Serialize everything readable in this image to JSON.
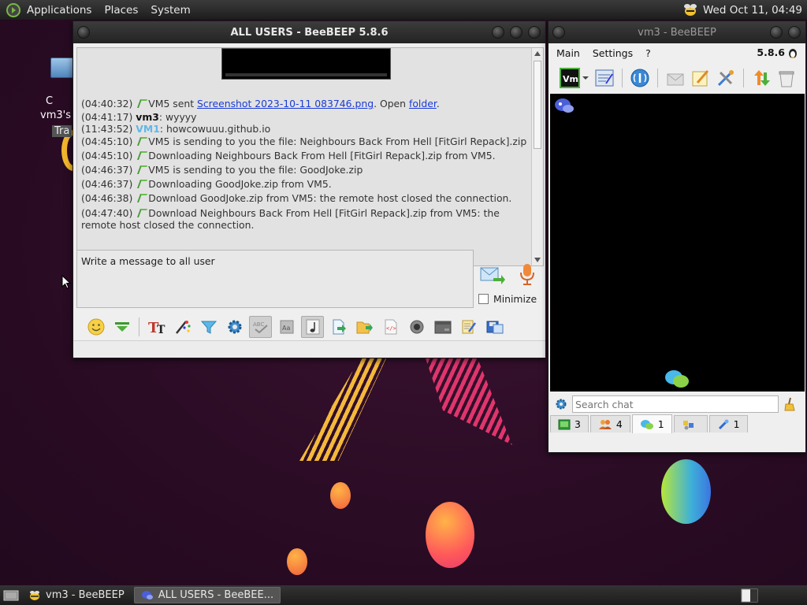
{
  "top_panel": {
    "menus": [
      "Applications",
      "Places",
      "System"
    ],
    "clock": "Wed Oct 11, 04:49"
  },
  "desktop_icon": {
    "label_line1": "C",
    "label_line2": "vm3's h",
    "label_line3": "Tra"
  },
  "chat_window": {
    "title": "ALL USERS - BeeBEEP 5.8.6",
    "lines": [
      {
        "ts": "(04:40:32)",
        "pre": "VM5 sent ",
        "link": "Screenshot 2023-10-11 083746.png",
        "mid": ". Open ",
        "link2": "folder",
        "post": "."
      },
      {
        "ts": "(04:41:17)",
        "nick": "vm3",
        "text": ": wyyyy"
      },
      {
        "ts": "(11:43:52)",
        "nick": "VM1",
        "text": ": howcowuuu.github.io"
      },
      {
        "ts": "(04:45:10)",
        "text": "VM5 is sending to you the file: Neighbours Back From Hell [FitGirl Repack].zip"
      },
      {
        "ts": "(04:45:10)",
        "text": "Downloading Neighbours Back From Hell [FitGirl Repack].zip from VM5."
      },
      {
        "ts": "(04:46:37)",
        "text": "VM5 is sending to you the file: GoodJoke.zip"
      },
      {
        "ts": "(04:46:37)",
        "text": "Downloading GoodJoke.zip from VM5."
      },
      {
        "ts": "(04:46:38)",
        "text": "Download GoodJoke.zip from VM5: the remote host closed the connection."
      },
      {
        "ts": "(04:47:40)",
        "text": "Download Neighbours Back From Hell [FitGirl Repack].zip from VM5: the remote host closed the connection."
      }
    ],
    "input_value": "Write a message to all user",
    "minimize_label": "Minimize"
  },
  "main_window": {
    "title": "vm3 - BeeBEEP",
    "menus": [
      "Main",
      "Settings",
      "?"
    ],
    "version": "5.8.6",
    "search_placeholder": "Search chat",
    "tabs": [
      {
        "count": "3"
      },
      {
        "count": "4"
      },
      {
        "count": "1"
      },
      {
        "count": ""
      },
      {
        "count": "1"
      }
    ]
  },
  "taskbar": {
    "items": [
      {
        "label": "vm3 - BeeBEEP"
      },
      {
        "label": "ALL USERS - BeeBEE..."
      }
    ]
  },
  "colors": {
    "accent_link": "#1a3bd6",
    "vm1_nick": "#62b6ea",
    "desktop_bg": "#2b0c25"
  }
}
